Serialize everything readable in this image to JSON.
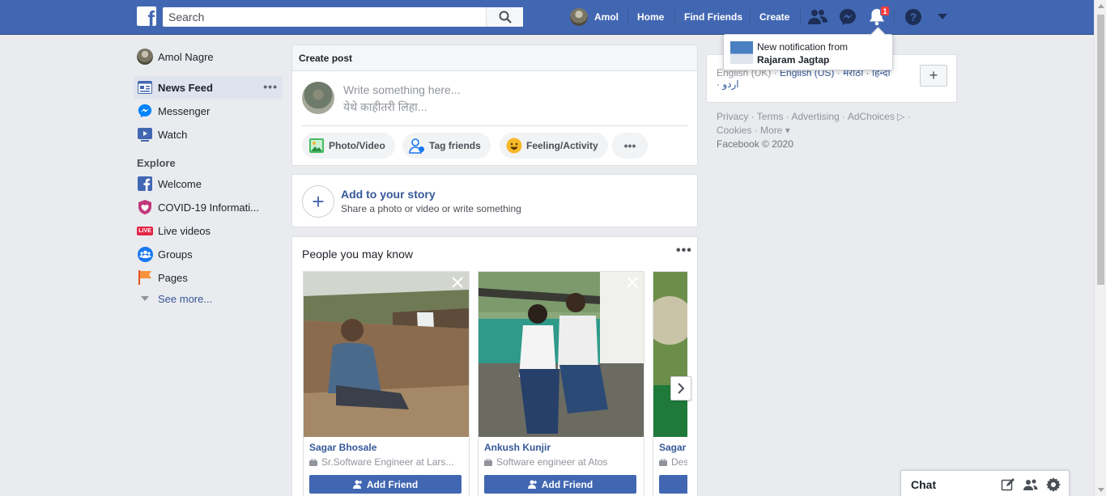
{
  "topbar": {
    "logo": "f",
    "search_placeholder": "Search",
    "profile_name": "Amol",
    "links": [
      "Home",
      "Find Friends",
      "Create"
    ],
    "notification_count": "1",
    "brand_color": "#4267b2"
  },
  "notification_popup": {
    "line1": "New notification from",
    "name": "Rajaram Jagtap"
  },
  "left_nav": {
    "profile": "Amol Nagre",
    "main_items": [
      {
        "label": "News Feed",
        "icon": "news-feed-icon"
      },
      {
        "label": "Messenger",
        "icon": "messenger-icon"
      },
      {
        "label": "Watch",
        "icon": "watch-icon"
      }
    ],
    "more_dots": "•••",
    "explore_heading": "Explore",
    "explore_items": [
      {
        "label": "Welcome",
        "icon": "facebook-icon"
      },
      {
        "label": "COVID-19 Informati...",
        "icon": "covid-heart-icon"
      },
      {
        "label": "Live videos",
        "icon": "live-icon"
      },
      {
        "label": "Groups",
        "icon": "groups-icon"
      },
      {
        "label": "Pages",
        "icon": "flag-icon"
      }
    ],
    "live_badge": "LIVE",
    "see_more": "See more..."
  },
  "create_post": {
    "header": "Create post",
    "placeholder_en": "Write something here...",
    "placeholder_mr": "येथे काहीतरी लिहा...",
    "actions": [
      "Photo/Video",
      "Tag friends",
      "Feeling/Activity"
    ],
    "more": "•••"
  },
  "story": {
    "plus": "+",
    "title": "Add to your story",
    "subtitle": "Share a photo or video or write something"
  },
  "pymk": {
    "title": "People you may know",
    "more": "•••",
    "people": [
      {
        "name": "Sagar Bhosale",
        "work": "Sr.Software Engineer at Lars...",
        "button": "Add Friend"
      },
      {
        "name": "Ankush Kunjir",
        "work": "Software engineer at Atos",
        "button": "Add Friend"
      },
      {
        "name": "Sagar",
        "work": "Des",
        "button": ""
      }
    ]
  },
  "languages": {
    "line1_prefix": "English (UK)",
    "sep": " · ",
    "current": "English (US)",
    "others": "मराठी · हिन्दी",
    "line2": "· اردو",
    "add": "+"
  },
  "footer": {
    "line1": "Privacy · Terms · Advertising · AdChoices ▷ ·",
    "line2": "Cookies · More ▾",
    "copyright": "Facebook © 2020"
  },
  "chat": {
    "label": "Chat"
  }
}
